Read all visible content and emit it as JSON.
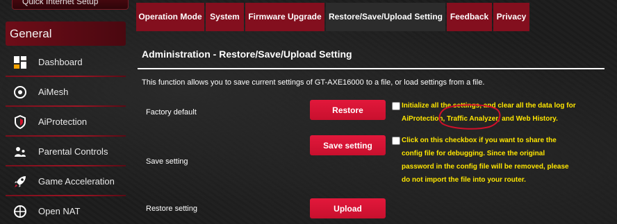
{
  "sidebar": {
    "quick_setup_label": "Quick Internet Setup",
    "section_title": "General",
    "items": [
      {
        "label": "Dashboard",
        "icon": "dashboard-icon"
      },
      {
        "label": "AiMesh",
        "icon": "aimesh-icon"
      },
      {
        "label": "AiProtection",
        "icon": "shield-icon"
      },
      {
        "label": "Parental Controls",
        "icon": "parental-controls-icon"
      },
      {
        "label": "Game Acceleration",
        "icon": "rocket-icon"
      },
      {
        "label": "Open NAT",
        "icon": "open-nat-icon"
      }
    ]
  },
  "tabs": [
    {
      "label": "Operation Mode",
      "active": false
    },
    {
      "label": "System",
      "active": false
    },
    {
      "label": "Firmware Upgrade",
      "active": false
    },
    {
      "label": "Restore/Save/Upload Setting",
      "active": true
    },
    {
      "label": "Feedback",
      "active": false
    },
    {
      "label": "Privacy",
      "active": false
    }
  ],
  "content": {
    "title": "Administration - Restore/Save/Upload Setting",
    "description": "This function allows you to save current settings of GT-AXE16000 to a file, or load settings from a file.",
    "rows": [
      {
        "label": "Factory default",
        "button": "Restore",
        "checked": false,
        "note_lines": [
          "Initialize all the settings, and clear all the data log for",
          "AiProtection, Traffic Analyzer, and Web History."
        ]
      },
      {
        "label": "Save setting",
        "button": "Save setting",
        "checked": false,
        "note_lines": [
          "Click on this checkbox if you want to share the",
          "config file for debugging. Since the original",
          "password in the config file will be removed, please",
          "do not import the file into your router."
        ]
      },
      {
        "label": "Restore setting",
        "button": "Upload"
      }
    ]
  },
  "colors": {
    "accent_red": "#c8102e",
    "tab_red": "#830f1e",
    "note_yellow": "#ffe600",
    "annotation_circle": "#d0102a"
  }
}
